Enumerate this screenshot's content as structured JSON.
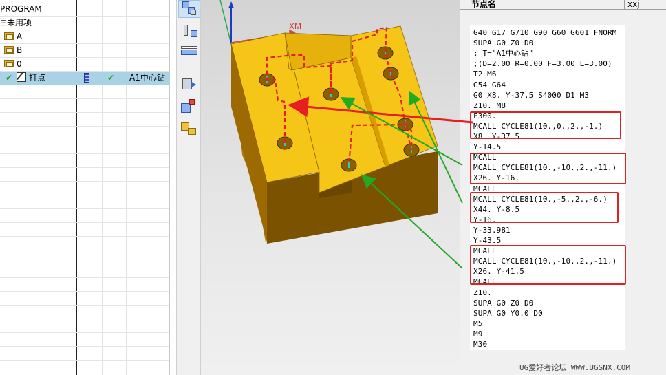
{
  "navigator": {
    "rows": [
      {
        "name": "PROGRAM",
        "tool_col": "",
        "check": "",
        "tool": ""
      },
      {
        "name": "未用项",
        "tool_col": "",
        "check": "",
        "tool": ""
      },
      {
        "name": "A",
        "tool_col": "",
        "check": "",
        "tool": ""
      },
      {
        "name": "B",
        "tool_col": "",
        "check": "",
        "tool": ""
      },
      {
        "name": "0",
        "tool_col": "",
        "check": "",
        "tool": ""
      },
      {
        "name": "打点",
        "tool_col": "",
        "check": "✔",
        "tool": "A1中心钻"
      }
    ],
    "check_glyph": "✔",
    "expand_glyph": "⊟",
    "selected_color": "#a9d2e6"
  },
  "viewport": {
    "axis_label": "XM",
    "part_color": "#f5c518",
    "part_side_color": "#c98a00",
    "toolpath_color": "#e62020"
  },
  "nc_panel": {
    "header_name": "节点名",
    "header_value": "xxj",
    "lines": [
      "G40 G17 G710 G90 G60 G601 FNORM",
      "SUPA G0 Z0 D0",
      "; T=\"A1中心钻\"",
      ";(D=2.00 R=0.00 F=3.00 L=3.00)",
      "T2 M6",
      "G54 G64",
      "G0 X8. Y-37.5 S4000 D1 M3",
      "Z10. M8",
      "F300.",
      "MCALL CYCLE81(10.,0.,2.,-1.)",
      "X8. Y-37.5",
      "Y-14.5",
      "MCALL",
      "MCALL CYCLE81(10.,-10.,2.,-11.)",
      "X26. Y-16.",
      "MCALL",
      "MCALL CYCLE81(10.,-5.,2.,-6.)",
      "X44. Y-8.5",
      "Y-16.",
      "Y-33.981",
      "Y-43.5",
      "MCALL",
      "MCALL CYCLE81(10.,-10.,2.,-11.)",
      "X26. Y-41.5",
      "MCALL",
      "Z10.",
      "SUPA G0 Z0 D0",
      "SUPA G0 Y0.0 D0",
      "M5",
      "M9",
      "M30"
    ],
    "highlight_color": "#e0221e",
    "annotation_arrow_color": "#22aa22"
  },
  "watermark": "UG爱好者论坛 WWW.UGSNX.COM"
}
